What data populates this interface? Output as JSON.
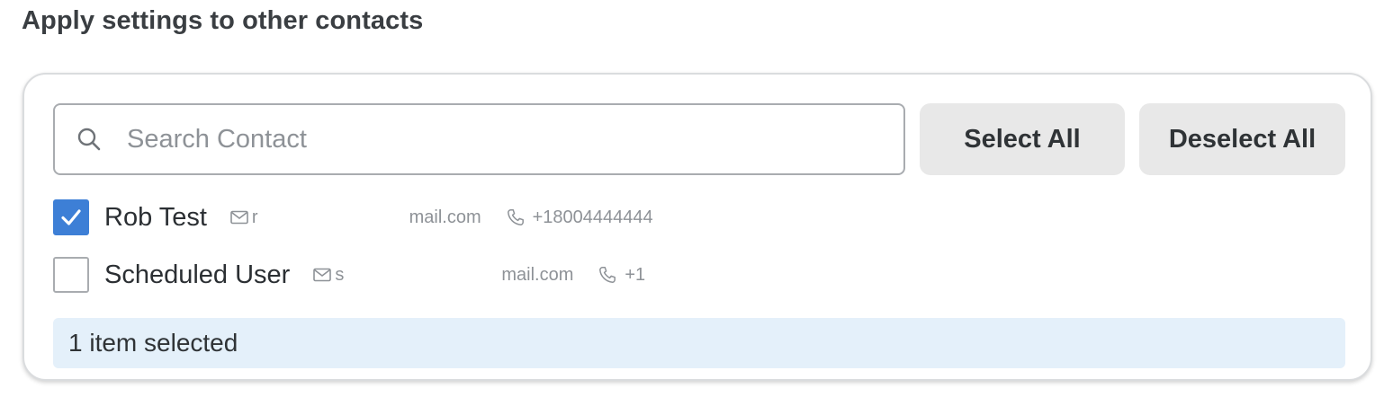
{
  "section": {
    "title": "Apply settings to other contacts"
  },
  "search": {
    "placeholder": "Search Contact",
    "value": "",
    "icon": "search-icon"
  },
  "buttons": {
    "select_all": "Select All",
    "deselect_all": "Deselect All"
  },
  "contacts": [
    {
      "name": "Rob Test",
      "checked": true,
      "email_start": "r",
      "email_end": "mail.com",
      "phone": "+18004444444"
    },
    {
      "name": "Scheduled User",
      "checked": false,
      "email_start": "s",
      "email_end": "mail.com",
      "phone": "+1"
    }
  ],
  "status": {
    "text": "1 item selected"
  },
  "colors": {
    "accent": "#3d7fd6",
    "status_background": "#e4f0fa",
    "button_background": "#e8e8e8"
  }
}
